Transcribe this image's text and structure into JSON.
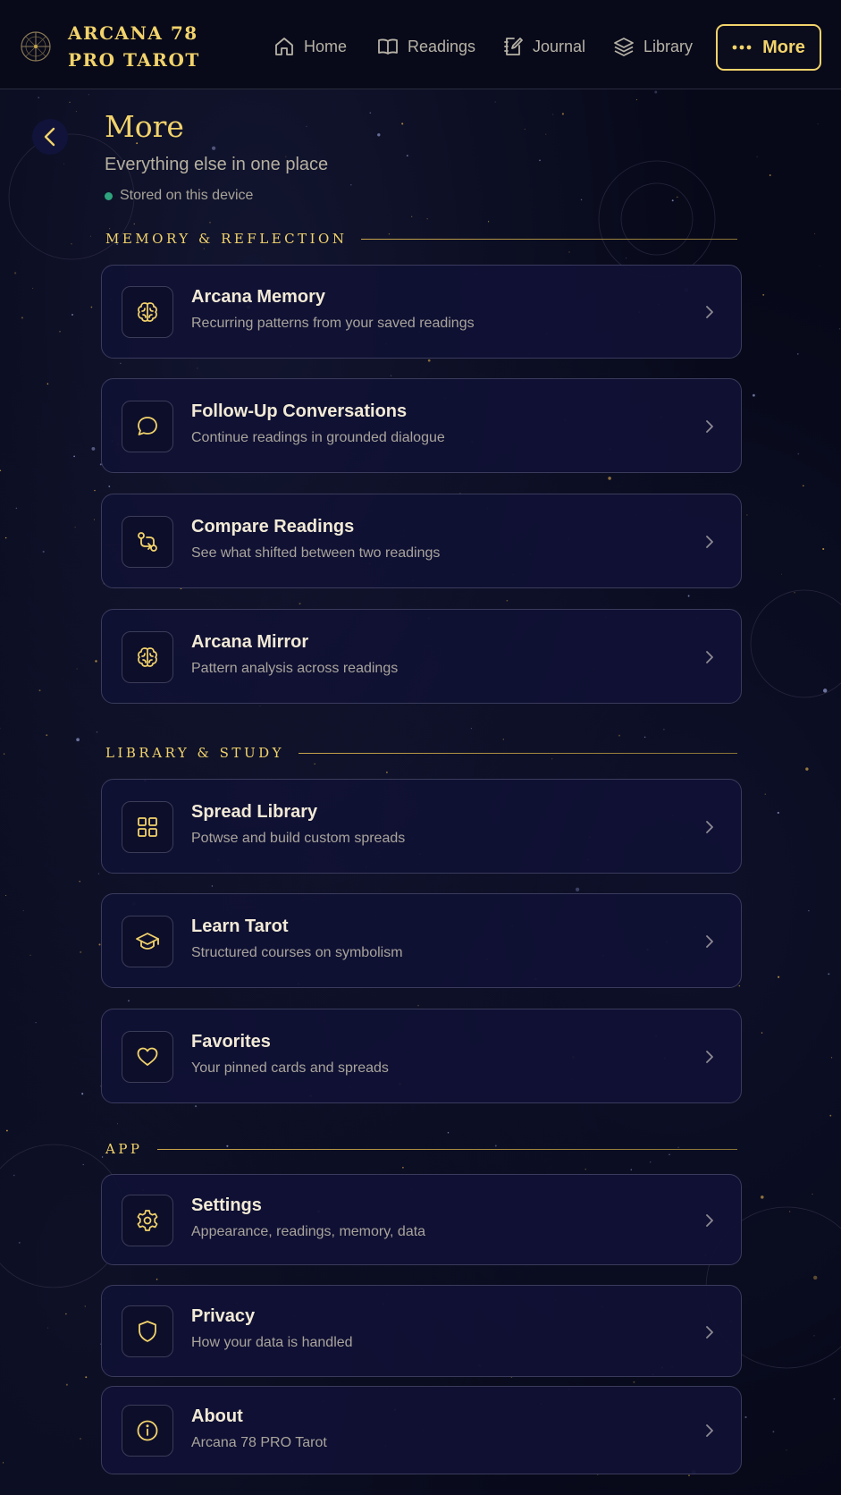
{
  "brand": {
    "name": "ARCANA 78 PRO TAROT"
  },
  "nav": {
    "home": "Home",
    "readings": "Readings",
    "journal": "Journal",
    "library": "Library",
    "more": "More"
  },
  "page": {
    "title": "More",
    "subtitle": "Everything else in one place",
    "storage_note": "Stored on this device"
  },
  "sections": [
    {
      "title": "MEMORY & REFLECTION",
      "items": [
        {
          "icon": "brain-icon",
          "title": "Arcana Memory",
          "desc": "Recurring patterns from your saved readings"
        },
        {
          "icon": "chat-bubble-icon",
          "title": "Follow-Up Conversations",
          "desc": "Continue readings in grounded dialogue"
        },
        {
          "icon": "compare-icon",
          "title": "Compare Readings",
          "desc": "See what shifted between two readings"
        },
        {
          "icon": "brain-icon",
          "title": "Arcana Mirror",
          "desc": "Pattern analysis across readings"
        }
      ]
    },
    {
      "title": "LIBRARY & STUDY",
      "items": [
        {
          "icon": "grid-icon",
          "title": "Spread Library",
          "desc": "Potwse and build custom spreads"
        },
        {
          "icon": "graduation-cap-icon",
          "title": "Learn Tarot",
          "desc": "Structured courses on symbolism"
        },
        {
          "icon": "heart-icon",
          "title": "Favorites",
          "desc": "Your pinned cards and spreads"
        }
      ]
    },
    {
      "title": "APP",
      "items": [
        {
          "icon": "gear-icon",
          "title": "Settings",
          "desc": "Appearance, readings, memory, data"
        },
        {
          "icon": "shield-icon",
          "title": "Privacy",
          "desc": "How your data is handled"
        },
        {
          "icon": "info-icon",
          "title": "About",
          "desc": "Arcana 78 PRO Tarot"
        }
      ]
    }
  ],
  "colors": {
    "accent": "#f2d36b",
    "background": "#070919",
    "card": "#101134",
    "status_dot": "#2ea37d"
  }
}
